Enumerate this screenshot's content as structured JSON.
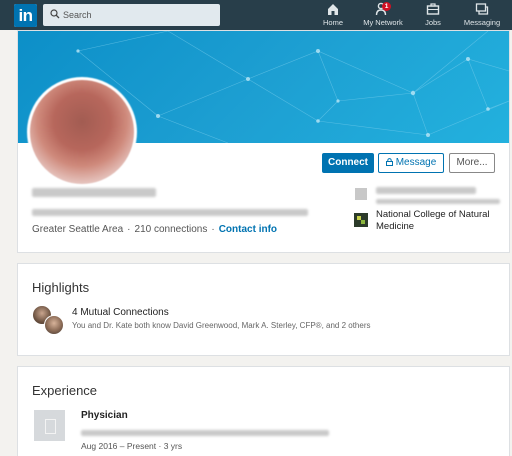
{
  "nav": {
    "logo": "in",
    "search_placeholder": "Search",
    "items": [
      {
        "label": "Home",
        "icon": "home-icon"
      },
      {
        "label": "My Network",
        "icon": "people-icon",
        "badge": "1"
      },
      {
        "label": "Jobs",
        "icon": "briefcase-icon"
      },
      {
        "label": "Messaging",
        "icon": "chat-icon"
      }
    ]
  },
  "profile": {
    "buttons": {
      "connect": "Connect",
      "message": "Message",
      "more": "More..."
    },
    "location": "Greater Seattle Area",
    "connections": "210 connections",
    "contact": "Contact info",
    "school": "National College of Natural Medicine",
    "accent": "#0073b1",
    "banner_color": "#1a9ad0"
  },
  "highlights": {
    "title": "Highlights",
    "mutual": "4 Mutual Connections",
    "mutual_detail": "You and Dr. Kate both know David Greenwood, Mark A. Sterley, CFP®, and 2 others"
  },
  "experience": {
    "title": "Experience",
    "position": "Physician",
    "dates": "Aug 2016 – Present · 3 yrs"
  }
}
